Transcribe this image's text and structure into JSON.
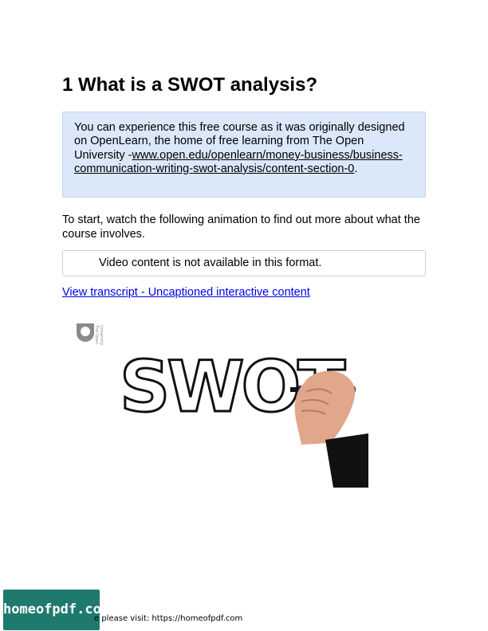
{
  "page": {
    "title": "1 What is a SWOT analysis?",
    "info_box": {
      "text": "You can experience this free course as it was originally designed on OpenLearn, the home of free learning from The Open University -",
      "link": "www.open.edu/openlearn/money-business/business-communication-writing-swot-analysis/content-section-0",
      "suffix": "."
    },
    "intro": "To start, watch the following animation to find out more about what the course involves.",
    "video_notice": "Video content is not available in this format.",
    "transcript_link": "View transcript - Uncaptioned interactive content",
    "video_still": {
      "logo_text": [
        "The Open",
        "University"
      ],
      "word": "SWOT"
    }
  },
  "footer": {
    "badge": "homeofpdf.com",
    "text": "e please visit: https://homeofpdf.com"
  },
  "colors": {
    "info_bg": "#dbe8f9",
    "link": "#0000ee",
    "badge_bg": "#1f7a6e"
  }
}
